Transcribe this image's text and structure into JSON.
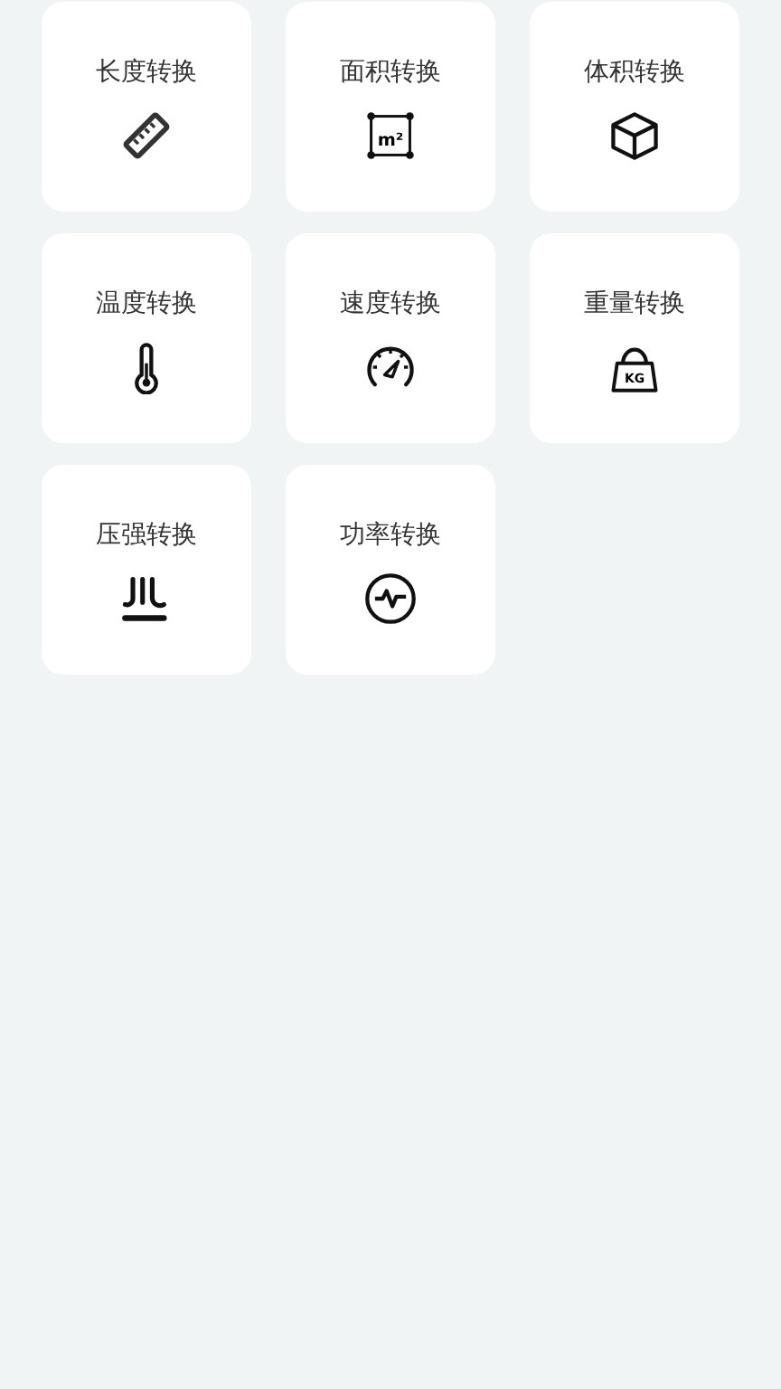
{
  "tools": [
    {
      "label": "长度转换",
      "kind": "ruler"
    },
    {
      "label": "面积转换",
      "kind": "area",
      "icon_text": "m²"
    },
    {
      "label": "体积转换",
      "kind": "cube"
    },
    {
      "label": "温度转换",
      "kind": "thermometer"
    },
    {
      "label": "速度转换",
      "kind": "speedometer"
    },
    {
      "label": "重量转换",
      "kind": "weight",
      "icon_text": "KG"
    },
    {
      "label": "压强转换",
      "kind": "pressure"
    },
    {
      "label": "功率转换",
      "kind": "power"
    }
  ]
}
